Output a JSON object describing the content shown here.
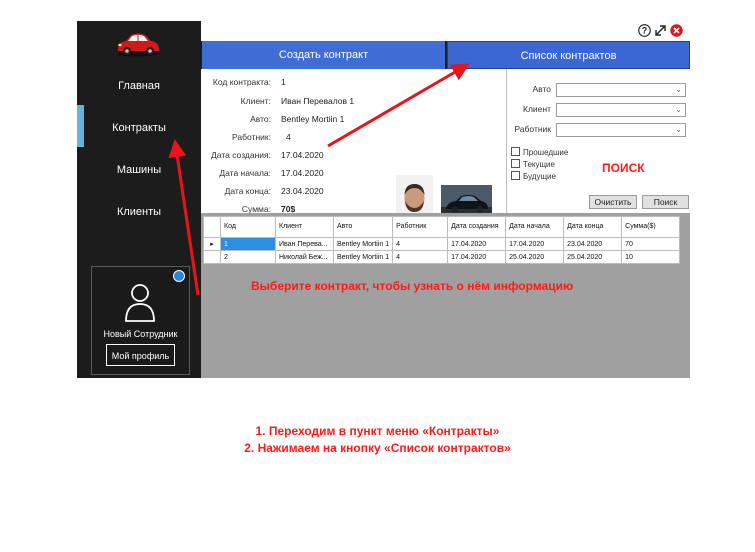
{
  "sidebar": {
    "logo_icon": "red-car-icon",
    "items": [
      {
        "label": "Главная"
      },
      {
        "label": "Контракты",
        "active": true
      },
      {
        "label": "Машины"
      },
      {
        "label": "Клиенты"
      }
    ],
    "profile": {
      "name": "Новый Сотрудник",
      "button_label": "Мой профиль",
      "avatar_icon": "user-avatar-icon"
    }
  },
  "titlebar": {
    "icons": [
      "help-icon",
      "resize-icon",
      "close-icon"
    ]
  },
  "tabs": [
    {
      "label": "Создать контракт"
    },
    {
      "label": "Список контрактов"
    }
  ],
  "details": {
    "fields": [
      {
        "label": "Код контракта:",
        "value": "1"
      },
      {
        "label": "Клиент:",
        "value": "Иван Перевалов 1"
      },
      {
        "label": "Авто:",
        "value": "Bentley Mortiin 1"
      },
      {
        "label": "Работник:",
        "value": "4"
      },
      {
        "label": "Дата создания:",
        "value": "17.04.2020"
      },
      {
        "label": "Дата начала:",
        "value": "17.04.2020"
      },
      {
        "label": "Дата конца:",
        "value": "23.04.2020"
      },
      {
        "label": "Сумма:",
        "value": "70$"
      }
    ]
  },
  "filters": {
    "selects": [
      {
        "label": "Авто",
        "value": ""
      },
      {
        "label": "Клиент",
        "value": ""
      },
      {
        "label": "Работник",
        "value": ""
      }
    ],
    "checkboxes": [
      {
        "label": "Прошедшие",
        "checked": false
      },
      {
        "label": "Текущие",
        "checked": false
      },
      {
        "label": "Будущие",
        "checked": false
      }
    ],
    "clear_label": "Очистить",
    "search_label": "Поиск",
    "annotation": "ПОИСК"
  },
  "grid": {
    "columns": [
      "Код",
      "Клиент",
      "Авто",
      "Работник",
      "Дата создания",
      "Дата начала",
      "Дата конца",
      "Сумма($)"
    ],
    "rows": [
      [
        "1",
        "Иван Перева...",
        "Bentley Mortiin 1",
        "4",
        "17.04.2020",
        "17.04.2020",
        "23.04.2020",
        "70"
      ],
      [
        "2",
        "Николай Беж...",
        "Bentley Mortiin 1",
        "4",
        "17.04.2020",
        "25.04.2020",
        "25.04.2020",
        "10"
      ]
    ],
    "selected_row": 0,
    "message": "Выберите контракт, чтобы узнать о нём информацию"
  },
  "instructions": [
    "1. Переходим в пункт меню «Контракты»",
    "2. Нажимаем на кнопку «Список контрактов»"
  ],
  "colors": {
    "tab_bg": "#3e6dd6",
    "sidebar_bg": "#1c1c1c",
    "annotation_red": "#ff1a1a",
    "active_nav_bar": "#66b2e0",
    "selected_cell": "#2e8ee0"
  }
}
